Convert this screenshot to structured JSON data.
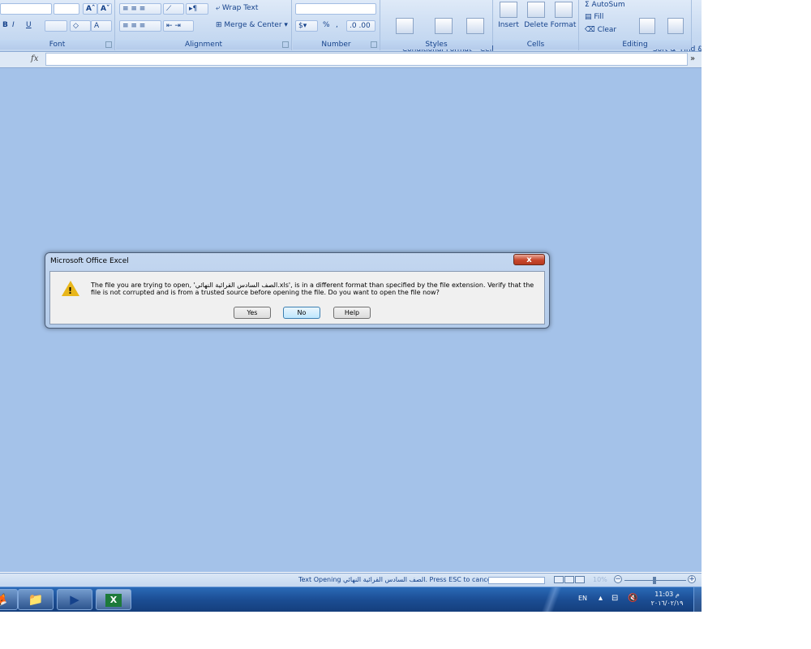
{
  "ribbon": {
    "font": {
      "label": "Font",
      "grow_label": "Aˆ",
      "shrink_label": "Aˇ",
      "bold": "B",
      "italic": "I",
      "underline": "U",
      "font_color": "A"
    },
    "alignment": {
      "label": "Alignment",
      "wrap_text": "Wrap Text",
      "merge_center": "Merge & Center"
    },
    "number": {
      "label": "Number",
      "percent": "%",
      "comma": ","
    },
    "styles": {
      "label": "Styles",
      "conditional_formatting": "Conditional\nFormatting",
      "format_as_table": "Format\nas Table",
      "cell_styles": "Cell\nStyles"
    },
    "cells": {
      "label": "Cells",
      "insert": "Insert",
      "delete": "Delete",
      "format": "Format"
    },
    "editing": {
      "label": "Editing",
      "autosum": "Σ AutoSum",
      "fill": "Fill",
      "clear": "Clear",
      "sort_filter": "Sort &\nFilter",
      "find_select": "Find &\nSelect"
    }
  },
  "formula_bar": {
    "fx": "fx",
    "value": ""
  },
  "dialog": {
    "title": "Microsoft Office Excel",
    "close": "x",
    "message": "The file you are trying to open, 'الصف السادس القرائية النهائي.xls', is in a different format than specified by the file extension. Verify that the file is not corrupted and is from a trusted source before opening the file. Do you want to open the file now?",
    "buttons": {
      "yes": "Yes",
      "no": "No",
      "help": "Help"
    }
  },
  "status_bar": {
    "text": "Text  Opening الصف السادس القرائية النهائي. Press ESC to cancel.",
    "zoom": "10%"
  },
  "taskbar": {
    "lang": "EN",
    "time": "11:03 م",
    "date": "٢٠١٦/٠٢/١٩"
  },
  "colors": {
    "workspace": "#a4c2e9",
    "taskbar": "#1b4d93",
    "warning": "#e8b61a",
    "close_button": "#c8462c"
  }
}
